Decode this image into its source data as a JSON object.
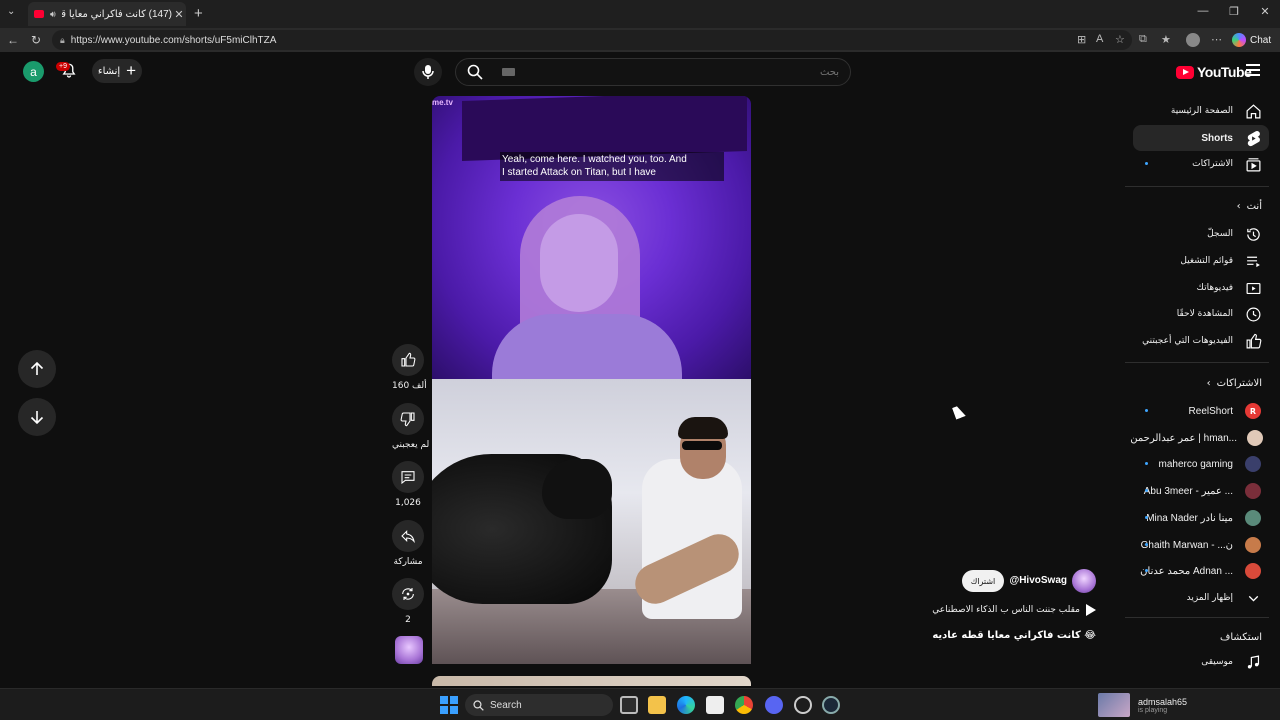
{
  "browser": {
    "tab_title": "(147) كانت فاكراني معايا قطه ...",
    "url": "https://www.youtube.com/shorts/uF5miClhTZA",
    "chat_label": "Chat"
  },
  "topbar": {
    "avatar_letter": "a",
    "notification_badge": "+9",
    "create_label": "إنشاء",
    "search_placeholder": "بحث",
    "logo_text": "YouTube"
  },
  "sidebar": {
    "main_items": [
      {
        "label": "الصفحة الرئيسية",
        "icon": "home-icon",
        "active": false
      },
      {
        "label": "Shorts",
        "icon": "shorts-icon",
        "active": true
      },
      {
        "label": "الاشتراكات",
        "icon": "subscriptions-icon",
        "active": false
      }
    ],
    "you_header": "أنت",
    "you_items": [
      {
        "label": "السجلّ",
        "icon": "history-icon"
      },
      {
        "label": "قوائم التشغيل",
        "icon": "playlists-icon"
      },
      {
        "label": "فيديوهاتك",
        "icon": "your-videos-icon"
      },
      {
        "label": "المشاهدة لاحقًا",
        "icon": "watch-later-icon"
      },
      {
        "label": "الفيديوهات التي أعجبتني",
        "icon": "liked-videos-icon"
      }
    ],
    "subs_header": "الاشتراكات",
    "subscriptions": [
      {
        "label": "ReelShort",
        "avatar": "R",
        "color": "#e53935"
      },
      {
        "label": "عمر عبدالرحمن | hman...",
        "avatar": "",
        "color": "#e0c9b8"
      },
      {
        "label": "maherco gaming",
        "avatar": "",
        "color": "#3a3f6b"
      },
      {
        "label": "Abu 3meer - عمير ...",
        "avatar": "",
        "color": "#7a2e3a"
      },
      {
        "label": "Mina Nader مينا نادر",
        "avatar": "",
        "color": "#5a8a7a"
      },
      {
        "label": "Ghaith Marwan - ...ن",
        "avatar": "",
        "color": "#c77b4a"
      },
      {
        "label": "محمد عدنان Adnan ...",
        "avatar": "",
        "color": "#d84a3a"
      }
    ],
    "show_more": "إظهار المزيد",
    "explore_header": "استكشاف",
    "explore_items": [
      {
        "label": "موسيقى",
        "icon": "music-icon"
      }
    ]
  },
  "video": {
    "watermark": "me.tv",
    "caption_line1": "Yeah, come here. I watched you, too. And",
    "caption_line2": "I started Attack on Titan, but I have"
  },
  "actions": {
    "likes": "160 ألف",
    "dislike_label": "لم يعجبني",
    "comments": "1,026",
    "share_label": "مشاركة",
    "remix_count": "2"
  },
  "info": {
    "channel": "@HivoSwag",
    "subscribe_label": "اشتراك",
    "audio_text": "مقلب جننت الناس ب الذكاء الاصطناعي",
    "title": "كانت فاكراني معايا قطه عاديه 😂"
  },
  "taskbar": {
    "search_label": "Search",
    "user_name": "admsalah65",
    "user_status": "is playing"
  }
}
